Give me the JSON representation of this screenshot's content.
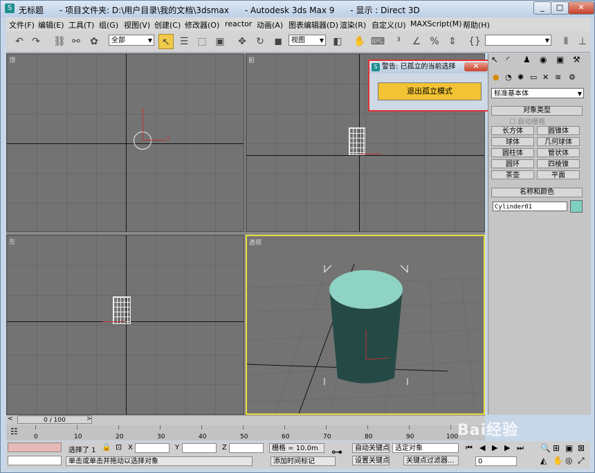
{
  "titlebar": {
    "title": "无标题      - 项目文件夹: D:\\用户目录\\我的文档\\3dsmax      - Autodesk 3ds Max 9      - 显示 : Direct 3D",
    "min": "_",
    "max": "□",
    "close": "✕"
  },
  "menu": [
    "文件(F)",
    "编辑(E)",
    "工具(T)",
    "组(G)",
    "视图(V)",
    "创建(C)",
    "修改器(O)",
    "reactor",
    "动画(A)",
    "图表编辑器(D)",
    "渲染(R)",
    "自定义(U)",
    "MAXScript(M)",
    "帮助(H)"
  ],
  "toolbar": {
    "selection_filter": "全部",
    "ref_coord": "视图",
    "named_sel": ""
  },
  "viewports": {
    "top": "顶",
    "front": "前",
    "left": "左",
    "perspective": "透视"
  },
  "axis_labels": {
    "x": "x",
    "y": "y",
    "z": "z"
  },
  "dialog": {
    "title": "警告: 已孤立的当前选择",
    "close": "✕",
    "button": "退出孤立模式"
  },
  "command_panel": {
    "category": "标准基本体",
    "rollout_type": "对象类型",
    "autogrid": "自动栅格",
    "objects": [
      "长方体",
      "圆锥体",
      "球体",
      "几何球体",
      "圆柱体",
      "管状体",
      "圆环",
      "四棱锥",
      "茶壶",
      "平面"
    ],
    "rollout_name": "名称和颜色",
    "object_name": "Cylinder01",
    "object_color": "#7fd0c0"
  },
  "timeline": {
    "slider": "0 / 100",
    "ticks": [
      "0",
      "10",
      "20",
      "30",
      "40",
      "50",
      "60",
      "70",
      "80",
      "90",
      "100"
    ]
  },
  "status": {
    "selected": "选择了 1",
    "x_label": "X",
    "y_label": "Y",
    "z_label": "Z",
    "grid": "栅格 = 10.0m",
    "auto_key": "自动关键点",
    "set_key": "设置关键点",
    "key_mode": "选定对象",
    "key_filters": "关键点过滤器...",
    "prompt": "单击或单击并拖动以选择对象",
    "add_time_tag": "添加时间标记",
    "frame": "0"
  },
  "watermark": "Bai经验"
}
